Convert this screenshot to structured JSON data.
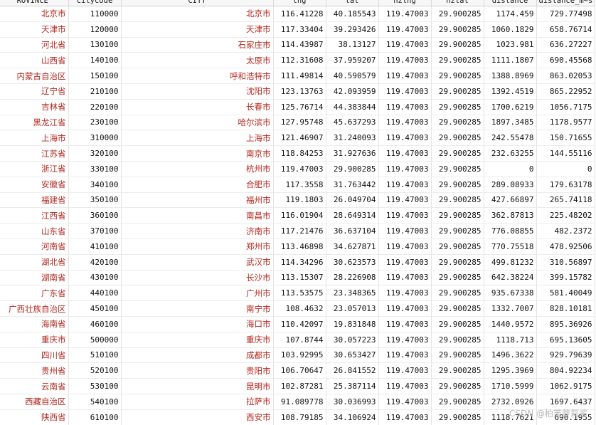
{
  "headers": [
    "ROVINCE",
    "citycode",
    "CITY",
    "lng",
    "lat",
    "hzlng",
    "hzlat",
    "distance",
    "distance_m~s"
  ],
  "rows": [
    [
      "北京市",
      "110000",
      "北京市",
      "116.41228",
      "40.185543",
      "119.47003",
      "29.900285",
      "1174.459",
      "729.77498"
    ],
    [
      "天津市",
      "120000",
      "天津市",
      "117.33404",
      "39.293426",
      "119.47003",
      "29.900285",
      "1060.1829",
      "658.76714"
    ],
    [
      "河北省",
      "130100",
      "石家庄市",
      "114.43987",
      "38.13127",
      "119.47003",
      "29.900285",
      "1023.981",
      "636.27227"
    ],
    [
      "山西省",
      "140100",
      "太原市",
      "112.31608",
      "37.959207",
      "119.47003",
      "29.900285",
      "1111.1807",
      "690.45568"
    ],
    [
      "内蒙古自治区",
      "150100",
      "呼和浩特市",
      "111.49814",
      "40.590579",
      "119.47003",
      "29.900285",
      "1388.8969",
      "863.02053"
    ],
    [
      "辽宁省",
      "210100",
      "沈阳市",
      "123.13763",
      "42.093959",
      "119.47003",
      "29.900285",
      "1392.4519",
      "865.22952"
    ],
    [
      "吉林省",
      "220100",
      "长春市",
      "125.76714",
      "44.383844",
      "119.47003",
      "29.900285",
      "1700.6219",
      "1056.7175"
    ],
    [
      "黑龙江省",
      "230100",
      "哈尔滨市",
      "127.95748",
      "45.637293",
      "119.47003",
      "29.900285",
      "1897.3485",
      "1178.9577"
    ],
    [
      "上海市",
      "310000",
      "上海市",
      "121.46907",
      "31.240093",
      "119.47003",
      "29.900285",
      "242.55478",
      "150.71655"
    ],
    [
      "江苏省",
      "320100",
      "南京市",
      "118.84253",
      "31.927636",
      "119.47003",
      "29.900285",
      "232.63255",
      "144.55116"
    ],
    [
      "浙江省",
      "330100",
      "杭州市",
      "119.47003",
      "29.900285",
      "119.47003",
      "29.900285",
      "0",
      "0"
    ],
    [
      "安徽省",
      "340100",
      "合肥市",
      "117.3558",
      "31.763442",
      "119.47003",
      "29.900285",
      "289.08933",
      "179.63178"
    ],
    [
      "福建省",
      "350100",
      "福州市",
      "119.1803",
      "26.049704",
      "119.47003",
      "29.900285",
      "427.66897",
      "265.74118"
    ],
    [
      "江西省",
      "360100",
      "南昌市",
      "116.01904",
      "28.649314",
      "119.47003",
      "29.900285",
      "362.87813",
      "225.48202"
    ],
    [
      "山东省",
      "370100",
      "济南市",
      "117.21476",
      "36.637104",
      "119.47003",
      "29.900285",
      "776.08855",
      "482.2372"
    ],
    [
      "河南省",
      "410100",
      "郑州市",
      "113.46898",
      "34.627871",
      "119.47003",
      "29.900285",
      "770.75518",
      "478.92506"
    ],
    [
      "湖北省",
      "420100",
      "武汉市",
      "114.34296",
      "30.623573",
      "119.47003",
      "29.900285",
      "499.81232",
      "310.56897"
    ],
    [
      "湖南省",
      "430100",
      "长沙市",
      "113.15307",
      "28.226908",
      "119.47003",
      "29.900285",
      "642.38224",
      "399.15782"
    ],
    [
      "广东省",
      "440100",
      "广州市",
      "113.53575",
      "23.348365",
      "119.47003",
      "29.900285",
      "935.67338",
      "581.40049"
    ],
    [
      "广西壮族自治区",
      "450100",
      "南宁市",
      "108.4632",
      "23.057013",
      "119.47003",
      "29.900285",
      "1332.7007",
      "828.10181"
    ],
    [
      "海南省",
      "460100",
      "海口市",
      "110.42097",
      "19.831848",
      "119.47003",
      "29.900285",
      "1440.9572",
      "895.36926"
    ],
    [
      "重庆市",
      "500000",
      "重庆市",
      "107.8744",
      "30.057223",
      "119.47003",
      "29.900285",
      "1118.713",
      "695.13605"
    ],
    [
      "四川省",
      "510100",
      "成都市",
      "103.92995",
      "30.653427",
      "119.47003",
      "29.900285",
      "1496.3622",
      "929.79639"
    ],
    [
      "贵州省",
      "520100",
      "贵阳市",
      "106.70647",
      "26.841552",
      "119.47003",
      "29.900285",
      "1295.3969",
      "804.92234"
    ],
    [
      "云南省",
      "530100",
      "昆明市",
      "102.87281",
      "25.387114",
      "119.47003",
      "29.900285",
      "1710.5999",
      "1062.9175"
    ],
    [
      "西藏自治区",
      "540100",
      "拉萨市",
      "91.089778",
      "30.036993",
      "119.47003",
      "29.900285",
      "2732.0926",
      "1697.6437"
    ],
    [
      "陕西省",
      "610100",
      "西安市",
      "108.79185",
      "34.106924",
      "119.47003",
      "29.900285",
      "1118.7621",
      "690.1955"
    ]
  ],
  "watermark": "CSDN @柏芙萝莉酱"
}
